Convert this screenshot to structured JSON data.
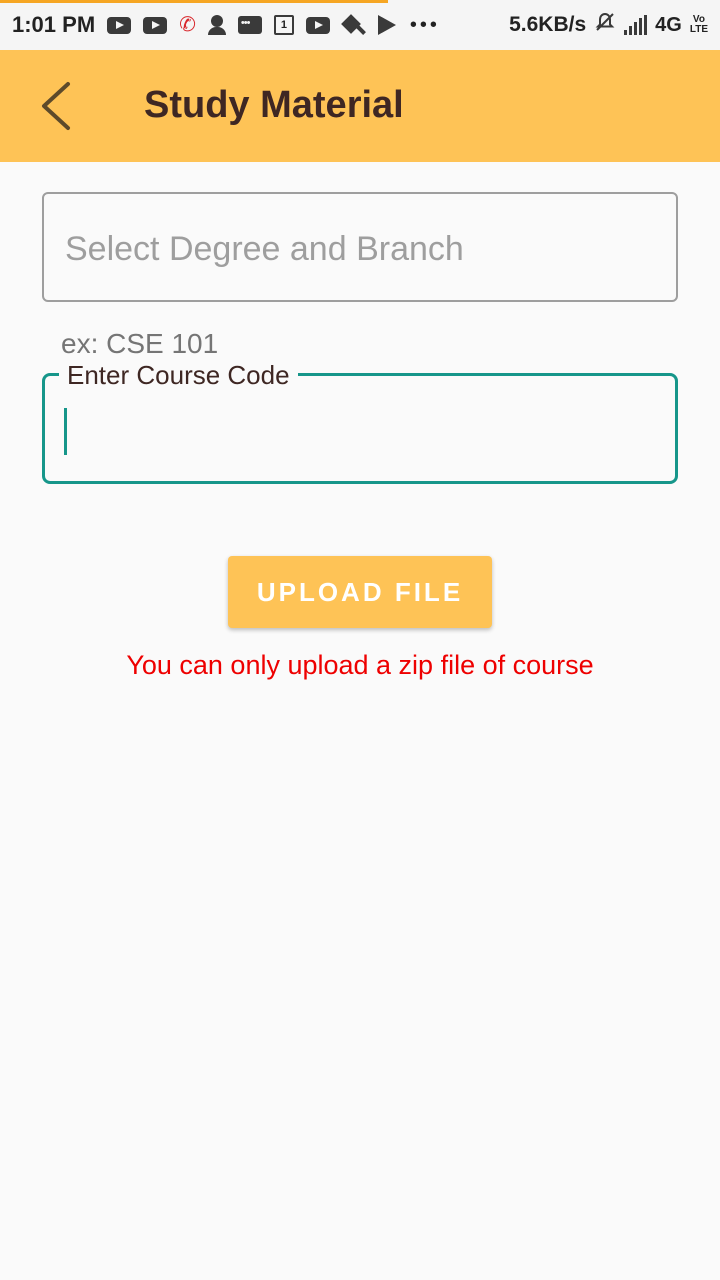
{
  "status_bar": {
    "time": "1:01 PM",
    "calendar_day": "1",
    "speed": "5.6KB/s",
    "network": "4G",
    "volte_top": "Vo",
    "volte_bottom": "LTE",
    "icons": [
      "youtube-icon",
      "youtube-icon",
      "missed-call-icon",
      "avatar-icon",
      "message-icon",
      "calendar-icon",
      "tool-icon",
      "play-store-icon",
      "more-dots-icon",
      "bell-off-icon",
      "signal-icon"
    ]
  },
  "app_bar": {
    "title": "Study Material",
    "background_color": "#fec356"
  },
  "form": {
    "degree_placeholder": "Select Degree and Branch",
    "course_helper": "ex: CSE 101",
    "course_label": "Enter Course Code",
    "course_value": "",
    "accent_color": "#16968a"
  },
  "upload": {
    "button_label": "UPLOAD FILE",
    "warning": "You can only upload a zip file of course",
    "warning_color": "#ee0000"
  }
}
